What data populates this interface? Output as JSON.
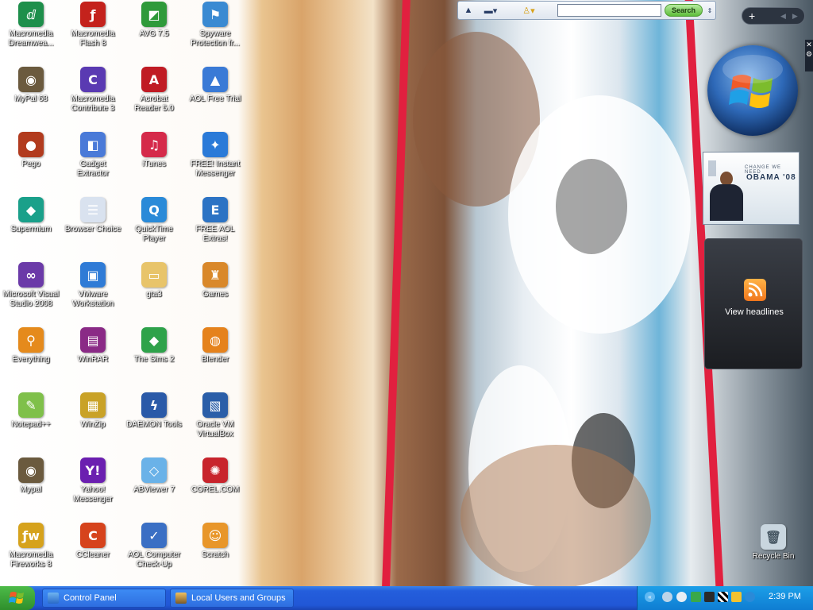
{
  "desktop": {
    "icons": [
      {
        "label": "Macromedia\nDreamwea...",
        "color": "#1e8f4b",
        "glyph": "ⅆ"
      },
      {
        "label": "MyPal 68",
        "color": "#6b5a3e",
        "glyph": "◉"
      },
      {
        "label": "Pego",
        "color": "#b23b1e",
        "glyph": "●"
      },
      {
        "label": "Supermium",
        "color": "#1aa08a",
        "glyph": "◆"
      },
      {
        "label": "Microsoft Visual\nStudio 2008",
        "color": "#6b3aa8",
        "glyph": "∞"
      },
      {
        "label": "Everything",
        "color": "#e58a1c",
        "glyph": "⚲"
      },
      {
        "label": "Notepad++",
        "color": "#7fc04a",
        "glyph": "✎"
      },
      {
        "label": "Mypal",
        "color": "#6b5a3e",
        "glyph": "◉"
      },
      {
        "label": "Macromedia\nFireworks 8",
        "color": "#d6a21c",
        "glyph": "ƒw"
      },
      {
        "label": "Macromedia\nFlash 8",
        "color": "#c4221c",
        "glyph": "ƒ"
      },
      {
        "label": "Macromedia\nContribute 3",
        "color": "#5a3ab2",
        "glyph": "C"
      },
      {
        "label": "Gadget\nExtractor",
        "color": "#4a7ad8",
        "glyph": "◧"
      },
      {
        "label": "Browser Choice",
        "color": "#d9e2ef",
        "glyph": "☰"
      },
      {
        "label": "VMware\nWorkstation",
        "color": "#2f7bd6",
        "glyph": "▣"
      },
      {
        "label": "WinRAR",
        "color": "#8a2a86",
        "glyph": "▤"
      },
      {
        "label": "WinZip",
        "color": "#c9a227",
        "glyph": "▦"
      },
      {
        "label": "Yahoo!\nMessenger",
        "color": "#6b1fb0",
        "glyph": "Y!"
      },
      {
        "label": "CCleaner",
        "color": "#d6431c",
        "glyph": "C"
      },
      {
        "label": "AVG 7.5",
        "color": "#2f9a3a",
        "glyph": "◩"
      },
      {
        "label": "Acrobat\nReader 5.0",
        "color": "#c01b24",
        "glyph": "A"
      },
      {
        "label": "iTunes",
        "color": "#d52a4a",
        "glyph": "♫"
      },
      {
        "label": "QuickTime\nPlayer",
        "color": "#2a8ad8",
        "glyph": "Q"
      },
      {
        "label": "gta3",
        "color": "#e8c46a",
        "glyph": "▭"
      },
      {
        "label": "The Sims 2",
        "color": "#2ea24a",
        "glyph": "◆"
      },
      {
        "label": "DAEMON Tools",
        "color": "#2a5aa8",
        "glyph": "ϟ"
      },
      {
        "label": "ABViewer 7",
        "color": "#6ab2e8",
        "glyph": "◇"
      },
      {
        "label": "AOL Computer\nCheck-Up",
        "color": "#3a6fc4",
        "glyph": "✓"
      },
      {
        "label": "Spyware\nProtection fr...",
        "color": "#3a8ad2",
        "glyph": "⚑"
      },
      {
        "label": "AOL Free Trial",
        "color": "#3a7ad6",
        "glyph": "▲"
      },
      {
        "label": "FREE! Instant\nMessenger",
        "color": "#2a7ad8",
        "glyph": "✦"
      },
      {
        "label": "FREE AOL\nExtras!",
        "color": "#2c73c4",
        "glyph": "E"
      },
      {
        "label": "Games",
        "color": "#d9882a",
        "glyph": "♜"
      },
      {
        "label": "Blender",
        "color": "#e5821c",
        "glyph": "◍"
      },
      {
        "label": "Oracle VM\nVirtualBox",
        "color": "#2a5ea8",
        "glyph": "▧"
      },
      {
        "label": "COREL.COM",
        "color": "#c8242c",
        "glyph": "✺"
      },
      {
        "label": "Scratch",
        "color": "#e8962a",
        "glyph": "☺"
      }
    ],
    "recycle_bin": {
      "label": "Recycle Bin"
    }
  },
  "toolbar": {
    "search_placeholder": "",
    "search_button": "Search"
  },
  "sidebar": {
    "add_button": "+",
    "obama_text_1": "CHANGE WE NEED",
    "obama_text_2": "OBAMA '08",
    "feed_label": "View headlines"
  },
  "taskbar": {
    "tasks": [
      {
        "label": "Control Panel"
      },
      {
        "label": "Local Users and Groups"
      }
    ],
    "clock": "2:39 PM"
  }
}
